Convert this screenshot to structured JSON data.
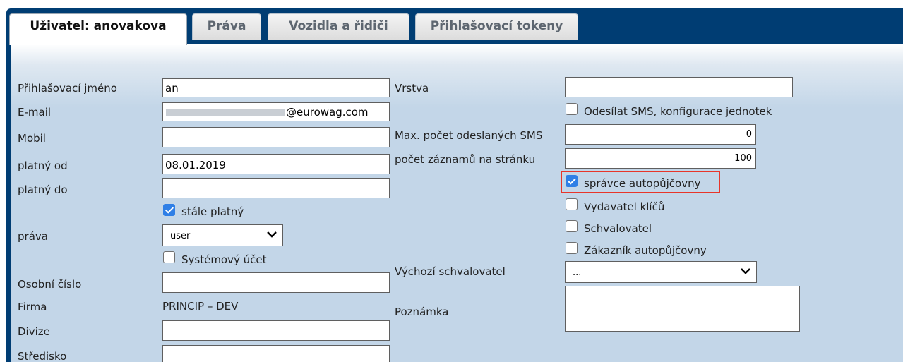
{
  "tabs": [
    {
      "label": "Uživatel: anovakova",
      "active": true
    },
    {
      "label": "Práva",
      "active": false
    },
    {
      "label": "Vozidla a řidiči",
      "active": false
    },
    {
      "label": "Přihlašovací tokeny",
      "active": false
    }
  ],
  "left": {
    "login_label": "Přihlašovací jméno",
    "login_value": "an",
    "email_label": "E-mail",
    "email_value": "@eurowag.com",
    "mobile_label": "Mobil",
    "mobile_value": "",
    "valid_from_label": "platný od",
    "valid_from_value": "08.01.2019",
    "valid_to_label": "platný do",
    "valid_to_value": "",
    "always_valid_label": "stále platný",
    "always_valid_checked": true,
    "rights_label": "práva",
    "rights_value": "user",
    "system_account_label": "Systémový účet",
    "system_account_checked": false,
    "personal_number_label": "Osobní číslo",
    "personal_number_value": "",
    "company_label": "Firma",
    "company_value": "PRINCIP – DEV",
    "division_label": "Divize",
    "division_value": "",
    "center_label": "Středisko",
    "center_value": ""
  },
  "right": {
    "layer_label": "Vrstva",
    "layer_value": "",
    "send_sms_label": "Odesílat SMS, konfigurace jednotek",
    "send_sms_checked": false,
    "max_sms_label": "Max. počet odeslaných SMS",
    "max_sms_value": "0",
    "records_label": "počet záznamů na stránku",
    "records_value": "100",
    "rental_admin_label": "správce autopůjčovny",
    "rental_admin_checked": true,
    "key_issuer_label": "Vydavatel klíčů",
    "key_issuer_checked": false,
    "approver_label": "Schvalovatel",
    "approver_checked": false,
    "rental_customer_label": "Zákazník autopůjčovny",
    "rental_customer_checked": false,
    "default_approver_label": "Výchozí schvalovatel",
    "default_approver_value": "...",
    "note_label": "Poznámka"
  },
  "colors": {
    "frame": "#003d73",
    "panel": "#c3d6e8",
    "checkbox_on": "#2f7fe6",
    "highlight": "#e8352a"
  }
}
